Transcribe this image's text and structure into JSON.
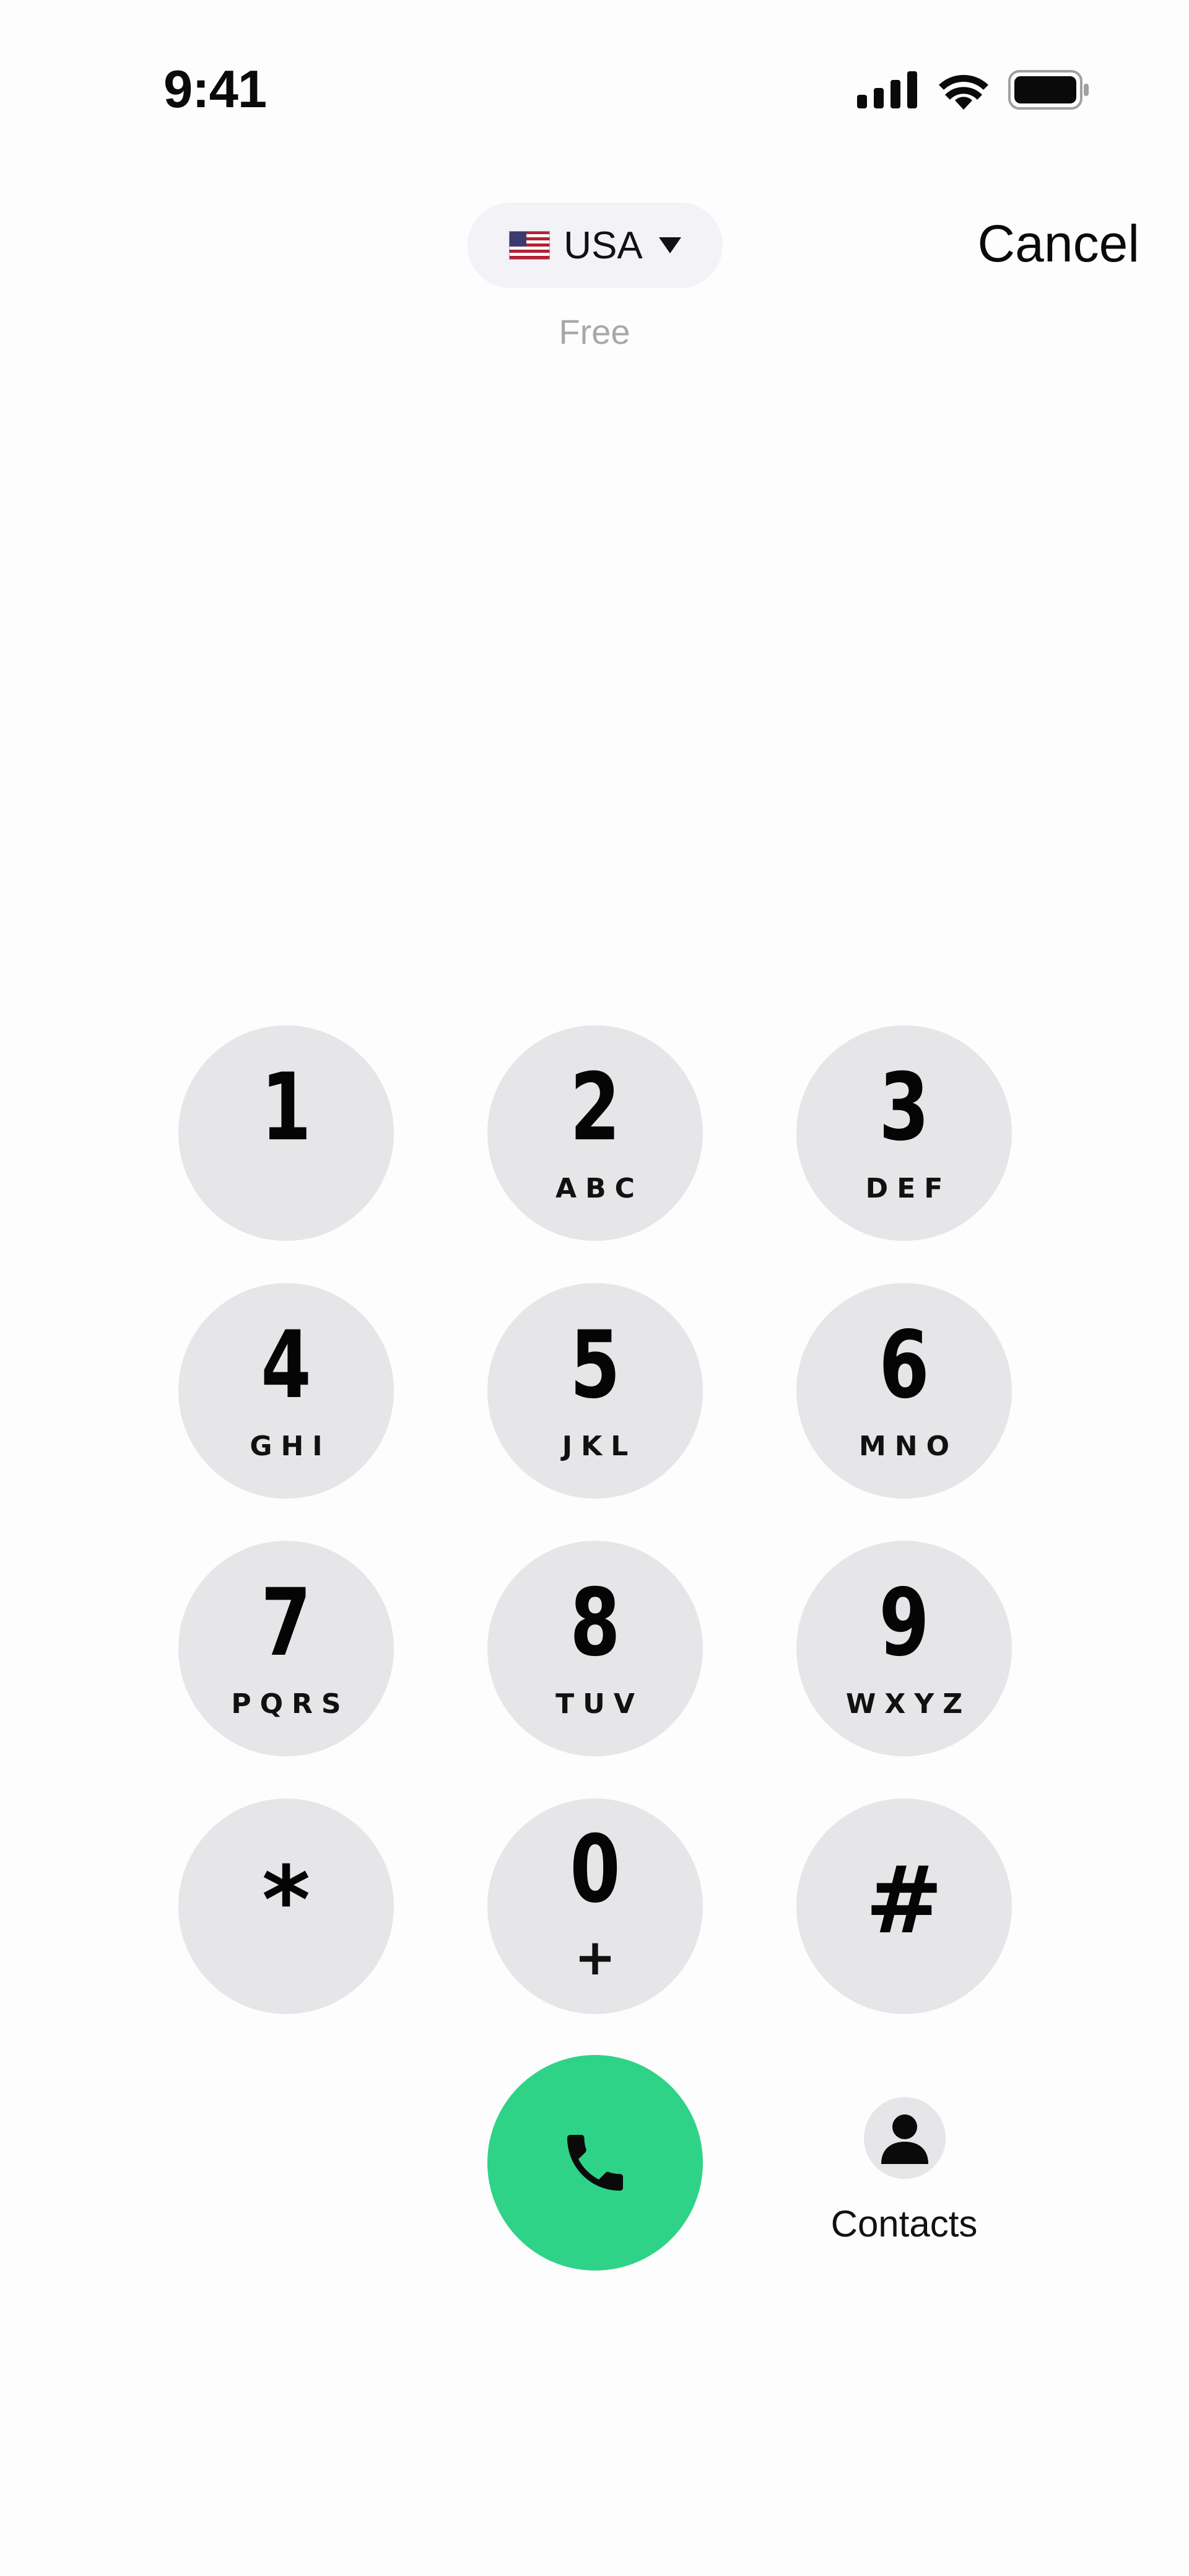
{
  "status_bar": {
    "time": "9:41"
  },
  "header": {
    "country_flag": "us-flag-icon",
    "country": "USA",
    "rate": "Free",
    "cancel_label": "Cancel"
  },
  "keypad": {
    "keys": [
      {
        "digit": "1",
        "letters": ""
      },
      {
        "digit": "2",
        "letters": "ABC"
      },
      {
        "digit": "3",
        "letters": "DEF"
      },
      {
        "digit": "4",
        "letters": "GHI"
      },
      {
        "digit": "5",
        "letters": "JKL"
      },
      {
        "digit": "6",
        "letters": "MNO"
      },
      {
        "digit": "7",
        "letters": "PQRS"
      },
      {
        "digit": "8",
        "letters": "TUV"
      },
      {
        "digit": "9",
        "letters": "WXYZ"
      },
      {
        "digit": "*",
        "letters": ""
      },
      {
        "digit": "0",
        "letters": "+"
      },
      {
        "digit": "#",
        "letters": ""
      }
    ]
  },
  "actions": {
    "call_icon": "phone-icon",
    "contacts_label": "Contacts"
  },
  "colors": {
    "call_button": "#2ed387",
    "key_background": "#e6e5e8",
    "pill_background": "#f2f2f7"
  }
}
